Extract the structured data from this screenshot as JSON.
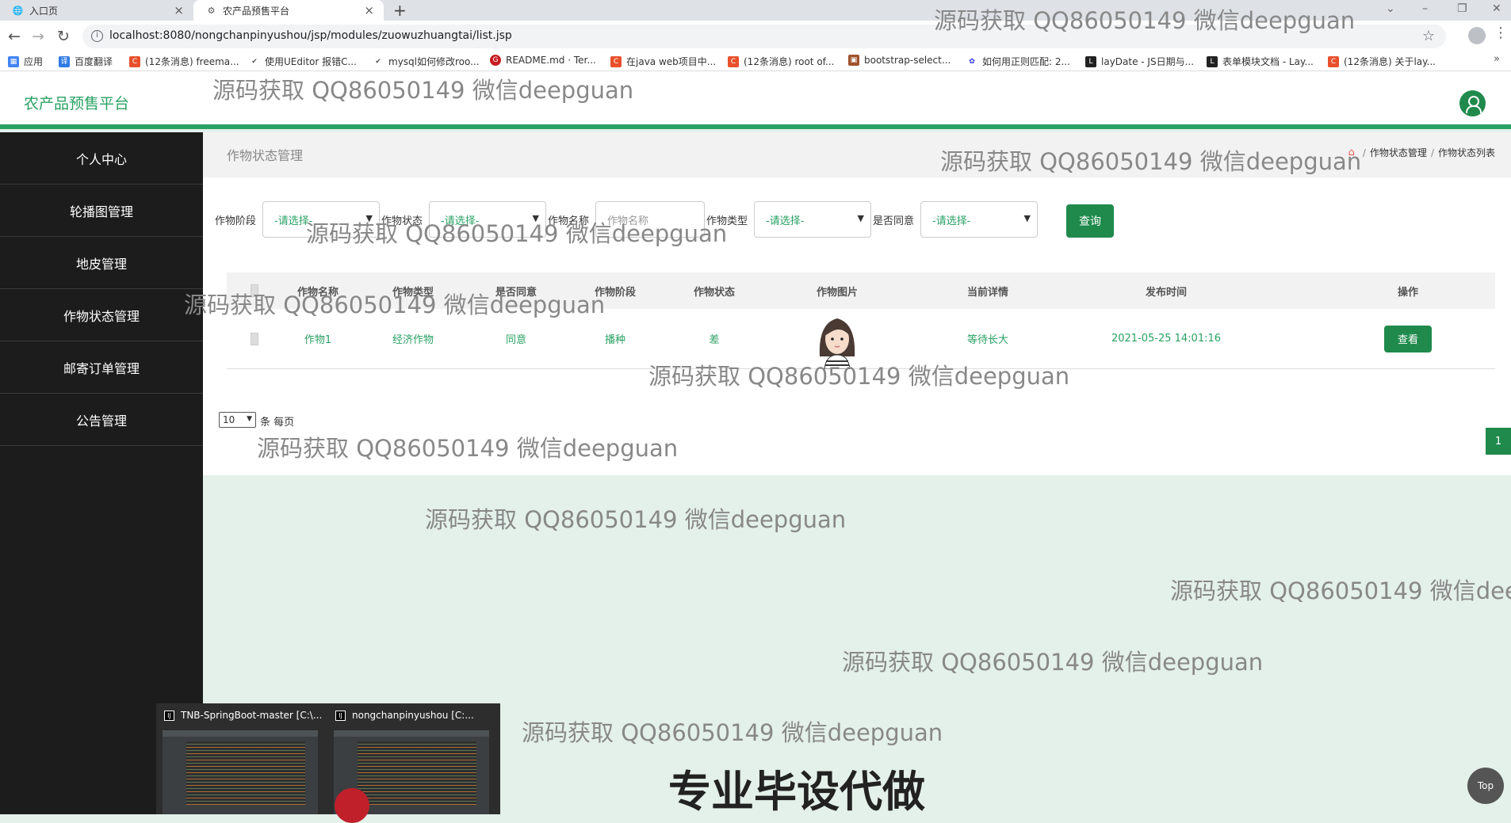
{
  "browser": {
    "tabs": [
      {
        "label": "入口页"
      },
      {
        "label": "农产品预售平台"
      }
    ],
    "new_tab": "+",
    "url": "localhost:8080/nongchanpinyushou/jsp/modules/zuowuzhuangtai/list.jsp",
    "bookmarks": [
      {
        "label": "应用",
        "color": "#4285f4"
      },
      {
        "label": "百度翻译",
        "color": "#2f7ae5"
      },
      {
        "label": "(12条消息) freema...",
        "color": "#e8502c"
      },
      {
        "label": "使用UEditor 报错C...",
        "color": "#555555"
      },
      {
        "label": "mysql如何修改roo...",
        "color": "#555555"
      },
      {
        "label": "README.md · Ter...",
        "color": "#c71d23"
      },
      {
        "label": "在java web项目中...",
        "color": "#e8502c"
      },
      {
        "label": "(12条消息) root of...",
        "color": "#e8502c"
      },
      {
        "label": "bootstrap-select...",
        "color": "#a0522d"
      },
      {
        "label": "如何用正则匹配: 2...",
        "color": "#2932e1"
      },
      {
        "label": "layDate - JS日期与...",
        "color": "#222222"
      },
      {
        "label": "表单模块文档 - Lay...",
        "color": "#222222"
      },
      {
        "label": "(12条消息) 关于lay...",
        "color": "#e8502c"
      }
    ]
  },
  "header": {
    "title": "农产品预售平台"
  },
  "sidebar": {
    "items": [
      {
        "label": "个人中心"
      },
      {
        "label": "轮播图管理"
      },
      {
        "label": "地皮管理"
      },
      {
        "label": "作物状态管理"
      },
      {
        "label": "邮寄订单管理"
      },
      {
        "label": "公告管理"
      }
    ]
  },
  "breadcrumb": {
    "page_title": "作物状态管理",
    "crumb1": "作物状态管理",
    "separator": "/",
    "crumb2": "作物状态列表"
  },
  "search": {
    "stage_label": "作物阶段",
    "stage_value": "-请选择-",
    "status_label": "作物状态",
    "status_value": "-请选择-",
    "name_label": "作物名称",
    "name_placeholder": "作物名称",
    "type_label": "作物类型",
    "type_value": "-请选择-",
    "agree_label": "是否同意",
    "agree_value": "-请选择-",
    "search_button": "查询"
  },
  "table": {
    "headers": {
      "name": "作物名称",
      "type": "作物类型",
      "agree": "是否同意",
      "stage": "作物阶段",
      "status": "作物状态",
      "image": "作物图片",
      "detail": "当前详情",
      "time": "发布时间",
      "action": "操作"
    },
    "rows": [
      {
        "name": "作物1",
        "type": "经济作物",
        "agree": "同意",
        "stage": "播种",
        "status": "差",
        "detail": "等待长大",
        "time": "2021-05-25 14:01:16",
        "action": "查看"
      }
    ]
  },
  "pager": {
    "page_size": "10",
    "per_page_label": "条 每页",
    "current_page": "1"
  },
  "taskbar": {
    "windows": [
      {
        "label": "TNB-SpringBoot-master [C:\\..."
      },
      {
        "label": "nongchanpinyushou [C:..."
      }
    ]
  },
  "watermark": {
    "text": "源码获取 QQ86050149 微信deepguan",
    "text_cut": "源码获取 QQ86050149 微信dee",
    "bottom": "专业毕设代做"
  },
  "top_button": "Top"
}
